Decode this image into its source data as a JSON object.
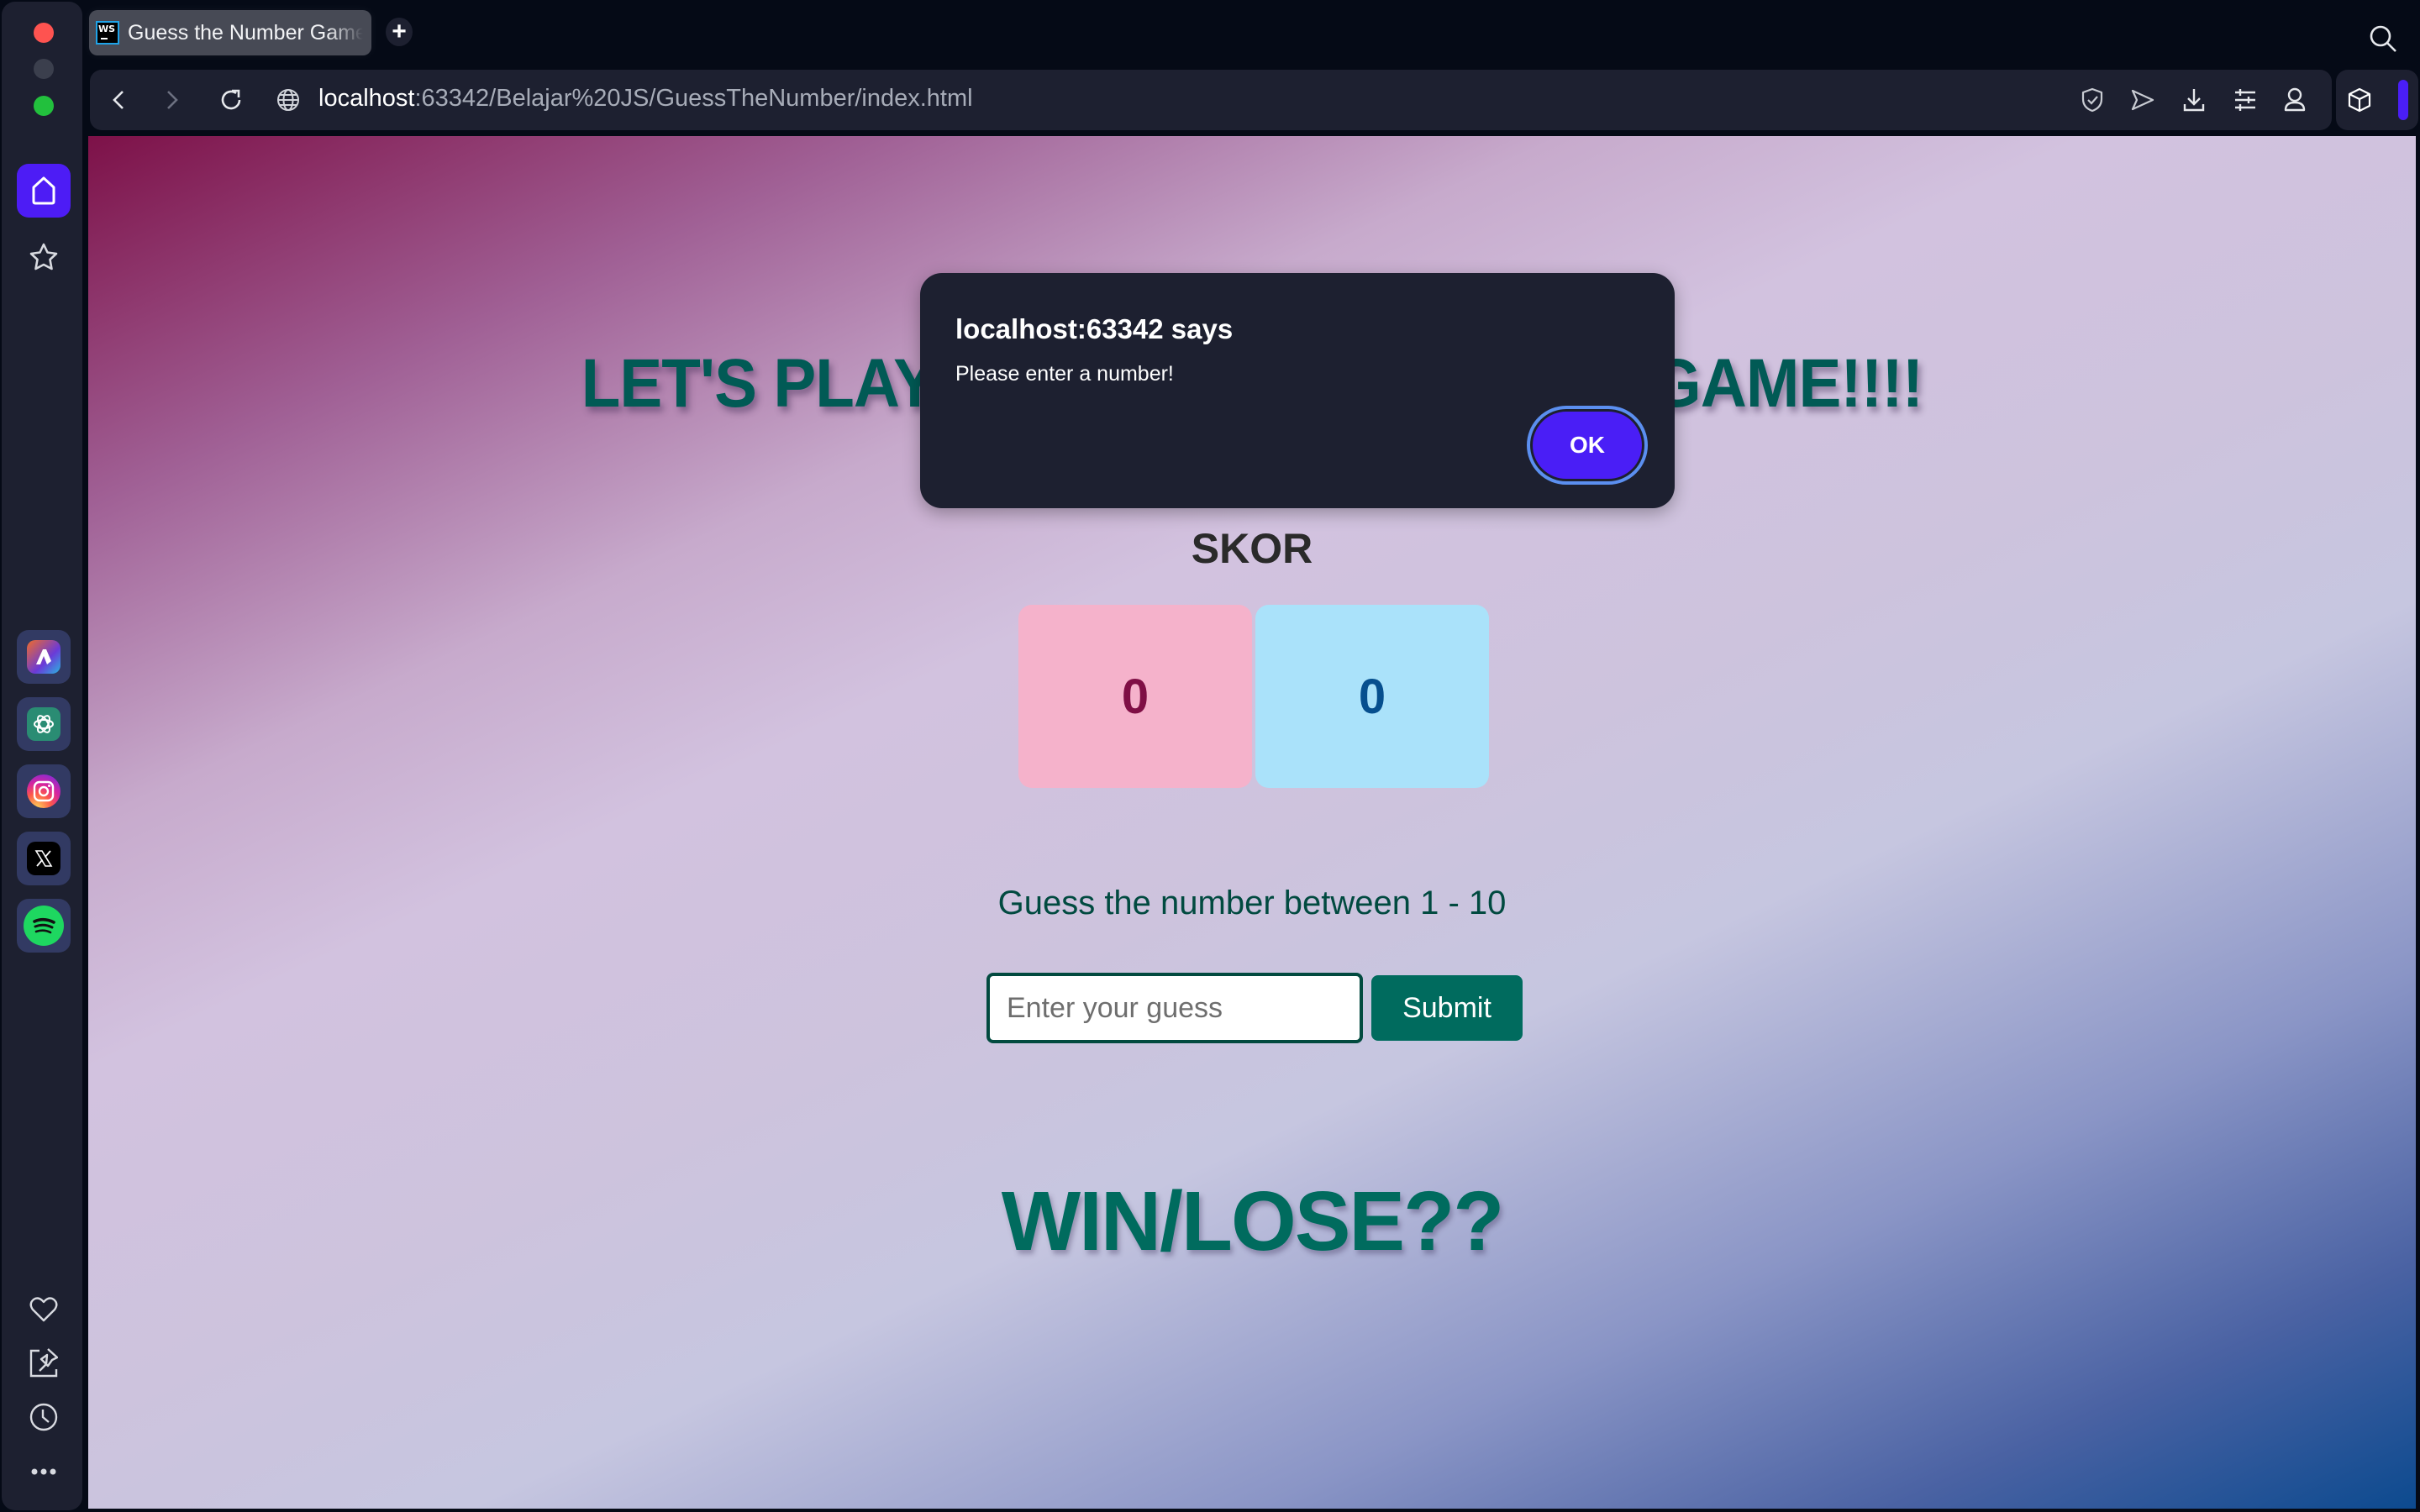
{
  "browser": {
    "tab": {
      "title": "Guess the Number Game",
      "favicon_text": "WS"
    },
    "new_tab_label": "+",
    "address": {
      "host": "localhost",
      "path": ":63342/Belajar%20JS/GuessTheNumber/index.html"
    },
    "toolbar_icons": [
      "shield-check-icon",
      "send-icon",
      "download-icon",
      "sliders-icon",
      "profile-icon",
      "extensions-cube-icon"
    ],
    "sidebar": {
      "top_items": [
        "home-icon",
        "star-icon"
      ],
      "apps": [
        "aria-icon",
        "chatgpt-icon",
        "instagram-icon",
        "x-icon",
        "spotify-icon"
      ],
      "bottom_items": [
        "heart-icon",
        "pinboard-icon",
        "history-clock-icon",
        "more-icon"
      ]
    }
  },
  "page": {
    "title": "LET'S PLAY A NUMBER GUESSING GAME!!!!",
    "score_label": "SKOR",
    "scores": {
      "player1": "0",
      "player2": "0"
    },
    "instruction": "Guess the number between 1 - 10",
    "input": {
      "value": "",
      "placeholder": "Enter your guess"
    },
    "submit_label": "Submit",
    "result_text": "WIN/LOSE??"
  },
  "dialog": {
    "title": "localhost:63342 says",
    "message": "Please enter a number!",
    "ok_label": "OK"
  },
  "colors": {
    "accent": "#4a1ef6",
    "title_teal": "#015a55",
    "button_teal": "#006b5e",
    "score_pink": "#f5b2cb",
    "score_blue": "#aae2fa"
  }
}
